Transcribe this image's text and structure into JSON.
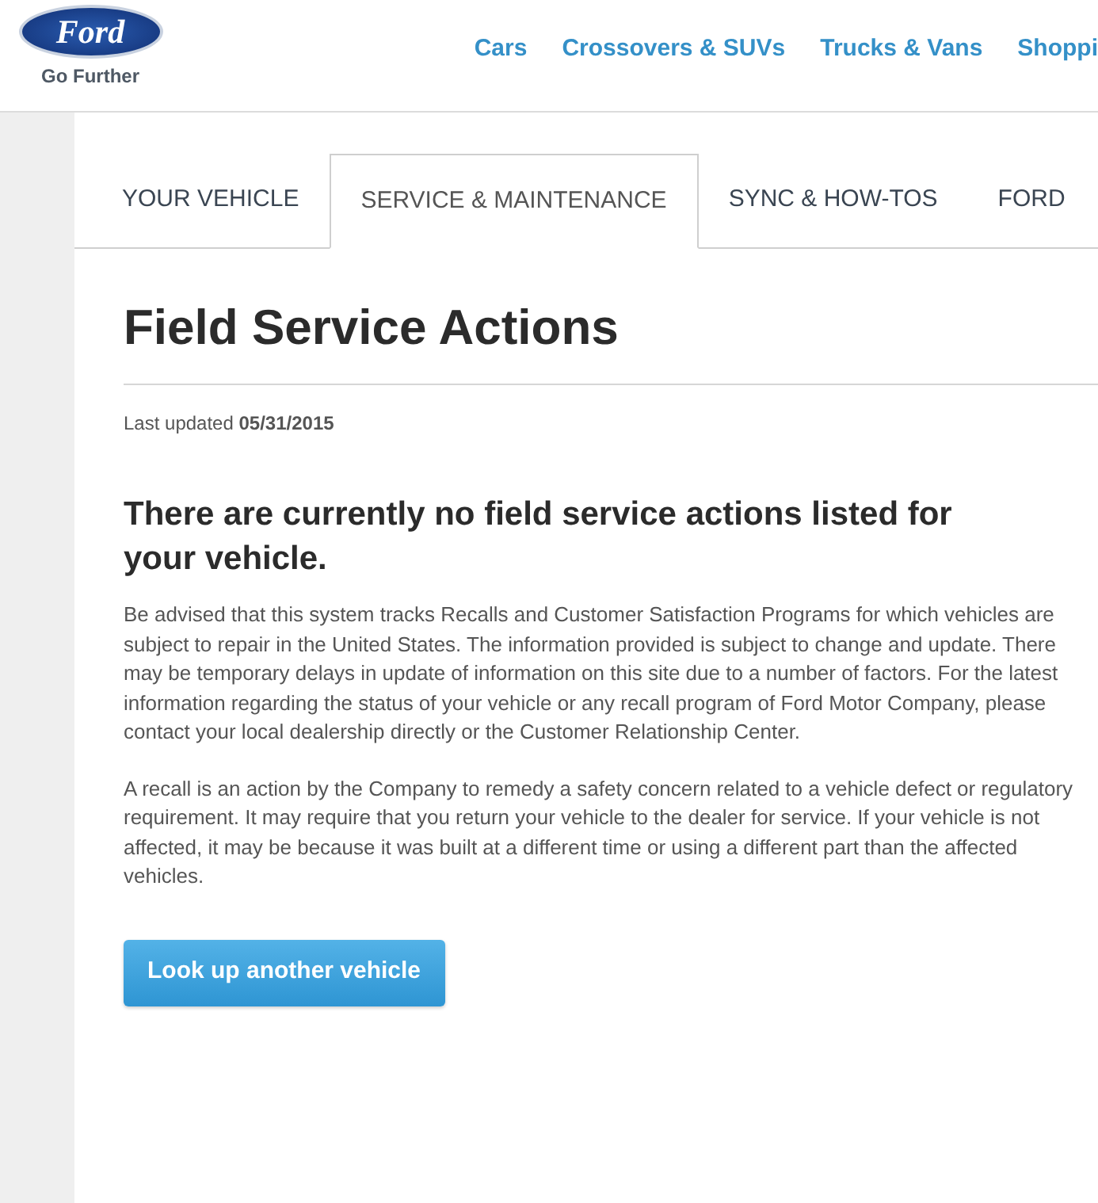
{
  "header": {
    "logo": {
      "wordmark": "Ford",
      "tagline": "Go Further"
    },
    "nav": [
      "Cars",
      "Crossovers & SUVs",
      "Trucks & Vans",
      "Shoppi"
    ]
  },
  "tabs": [
    {
      "label": "YOUR VEHICLE",
      "selected": false
    },
    {
      "label": "SERVICE & MAINTENANCE",
      "selected": true
    },
    {
      "label": "SYNC & HOW-TOS",
      "selected": false
    },
    {
      "label": "FORD",
      "selected": false
    }
  ],
  "page": {
    "title": "Field Service Actions",
    "last_updated": "Last updated **05/31/2015**",
    "heading": "There are currently no field service actions listed for your vehicle.",
    "paragraphs": [
      "Be advised that this system tracks Recalls and Customer Satisfaction Programs for which vehicles are subject to repair in the United States. The information provided is subject to change and update. There may be temporary delays in update of information on this site due to a number of factors. For the latest information regarding the status of your vehicle or any recall program of Ford Motor Company, please contact your local dealership directly or the Customer Relationship Center.",
      "A recall is an action by the Company to remedy a safety concern related to a vehicle defect or regulatory requirement. It may require that you return your vehicle to the dealer for service. If your vehicle is not affected, it may be because it was built at a different time or using a different part than the affected vehicles."
    ],
    "button": "Look up another vehicle"
  }
}
